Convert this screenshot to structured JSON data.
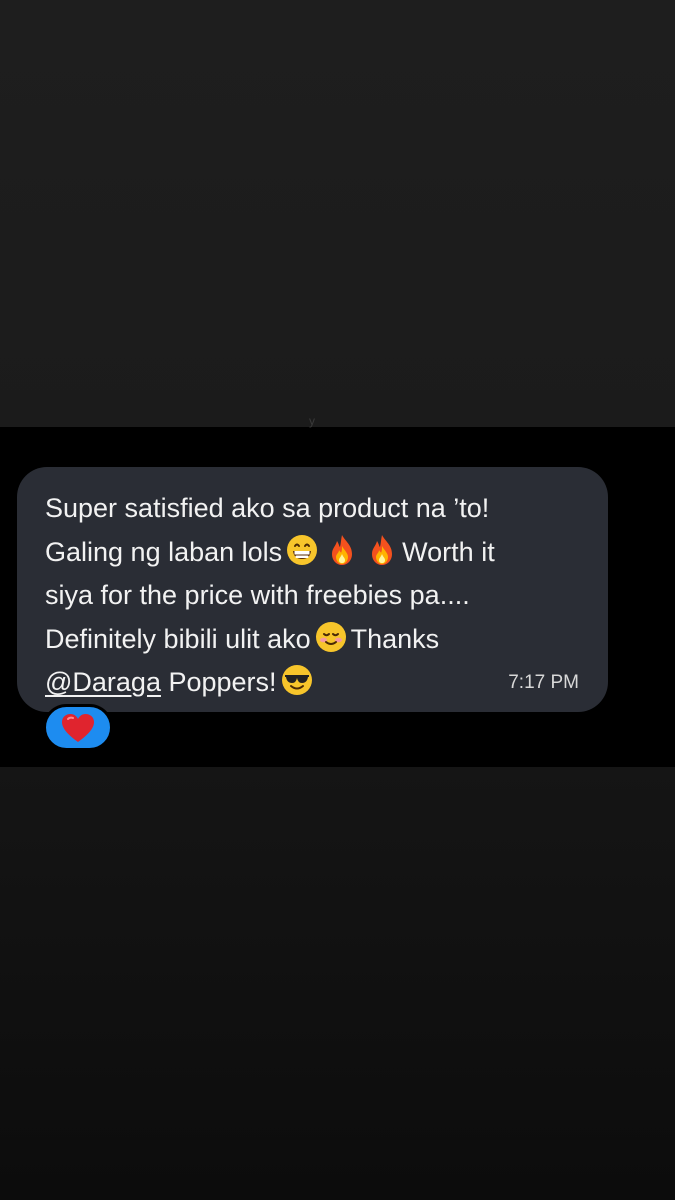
{
  "message": {
    "line1": "Super satisfied ako sa product na ’to!",
    "line2_start": "Galing ng laban lols",
    "line2_end": "Worth it",
    "line3": "siya for the price with freebies pa....",
    "line4_start": "Definitely bibili ulit ako",
    "line4_end": "Thanks",
    "mention": "@Daraga",
    "line5_after_mention": "Poppers!",
    "emojis": [
      "grinning-face-icon",
      "fire-icon",
      "fire-icon",
      "smiling-face-icon",
      "sunglasses-face-icon"
    ],
    "timestamp": "7:17 PM"
  },
  "reaction": {
    "icon": "red-heart-icon",
    "pill_color": "#1d8cf0"
  },
  "colors": {
    "bubble": "#2a2d35",
    "chat_background": "#000000",
    "text": "#f2f2f2"
  }
}
